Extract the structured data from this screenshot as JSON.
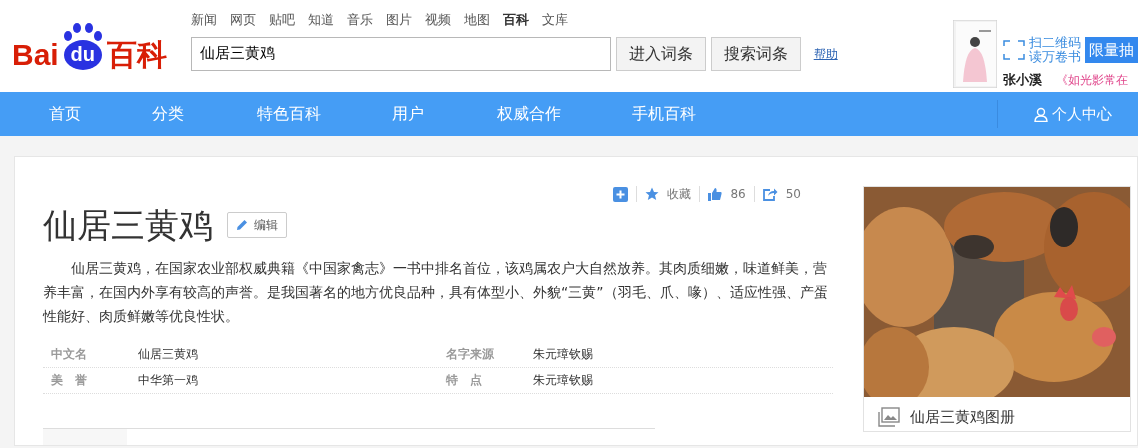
{
  "logo": {
    "part_1": "Bai",
    "part_2": "du",
    "part_3": "百科"
  },
  "top_links": [
    {
      "label": "新闻",
      "selected": false
    },
    {
      "label": "网页",
      "selected": false
    },
    {
      "label": "贴吧",
      "selected": false
    },
    {
      "label": "知道",
      "selected": false
    },
    {
      "label": "音乐",
      "selected": false
    },
    {
      "label": "图片",
      "selected": false
    },
    {
      "label": "视频",
      "selected": false
    },
    {
      "label": "地图",
      "selected": false
    },
    {
      "label": "百科",
      "selected": true
    },
    {
      "label": "文库",
      "selected": false
    }
  ],
  "search": {
    "value": "仙居三黄鸡",
    "buttons": [
      "进入词条",
      "搜索词条"
    ],
    "help": "帮助"
  },
  "ad": {
    "scan_line_1": "扫二维码",
    "scan_line_2": "读万卷书",
    "badge": "限量抽",
    "author": "张小溪",
    "book_title": "《如光影常在"
  },
  "nav": {
    "items": [
      {
        "label": "首页",
        "selected": false
      },
      {
        "label": "分类",
        "selected": false
      },
      {
        "label": "特色百科",
        "selected": false
      },
      {
        "label": "用户",
        "selected": false
      },
      {
        "label": "权威合作",
        "selected": false
      },
      {
        "label": "手机百科",
        "selected": false
      }
    ],
    "user_center": "个人中心"
  },
  "actions": {
    "favorite": "收藏",
    "likes": "86",
    "shares": "50"
  },
  "article": {
    "title": "仙居三黄鸡",
    "edit": "编辑",
    "summary": "仙居三黄鸡，在国家农业部权威典籍《中国家禽志》一书中排名首位，该鸡属农户大自然放养。其肉质细嫩，味道鲜美，营养丰富，在国内外享有较高的声誉。是我国著名的地方优良品种，具有体型小、外貌“三黄”（羽毛、爪、喙）、适应性强、产蛋性能好、肉质鲜嫩等优良性状。",
    "info": [
      {
        "label": "中文名",
        "value": "仙居三黄鸡"
      },
      {
        "label": "名字来源",
        "value": "朱元璋钦赐"
      },
      {
        "label": "美　誉",
        "value": "中华第一鸡"
      },
      {
        "label": "特　点",
        "value": "朱元璋钦赐"
      }
    ]
  },
  "album": {
    "kind": "picture",
    "caption": "仙居三黄鸡图册"
  }
}
